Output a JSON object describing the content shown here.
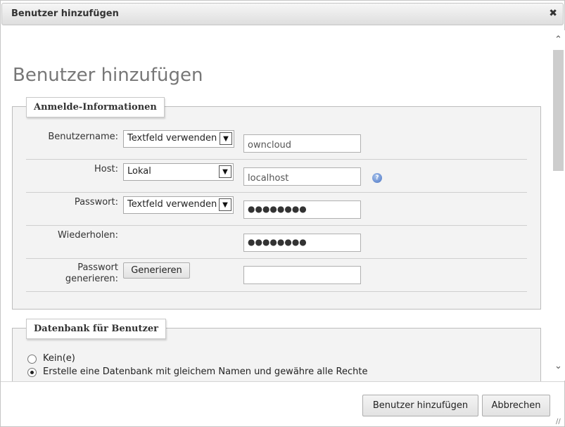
{
  "dialog": {
    "title": "Benutzer hinzufügen",
    "close_symbol": "✖"
  },
  "page": {
    "title": "Benutzer hinzufügen"
  },
  "login_info": {
    "legend": "Anmelde-Informationen",
    "username": {
      "label": "Benutzername:",
      "select_value": "Textfeld verwenden",
      "input_value": "owncloud"
    },
    "host": {
      "label": "Host:",
      "select_value": "Lokal",
      "input_value": "localhost",
      "help_symbol": "?"
    },
    "password": {
      "label": "Passwort:",
      "select_value": "Textfeld verwenden",
      "input_value": "●●●●●●●●"
    },
    "repeat": {
      "label": "Wiederholen:",
      "input_value": "●●●●●●●●"
    },
    "generate": {
      "label_line1": "Passwort",
      "label_line2": "generieren:",
      "button_label": "Generieren",
      "input_value": ""
    }
  },
  "database": {
    "legend": "Datenbank für Benutzer",
    "options": [
      {
        "label": "Kein(e)",
        "checked": false
      },
      {
        "label": "Erstelle eine Datenbank mit gleichem Namen und gewähre alle Rechte",
        "checked": true
      }
    ]
  },
  "footer": {
    "add_label": "Benutzer hinzufügen",
    "cancel_label": "Abbrechen"
  },
  "icons": {
    "select_arrow": "chevron-down-icon",
    "scroll_up": "chevron-up-icon",
    "scroll_down": "chevron-down-icon"
  }
}
